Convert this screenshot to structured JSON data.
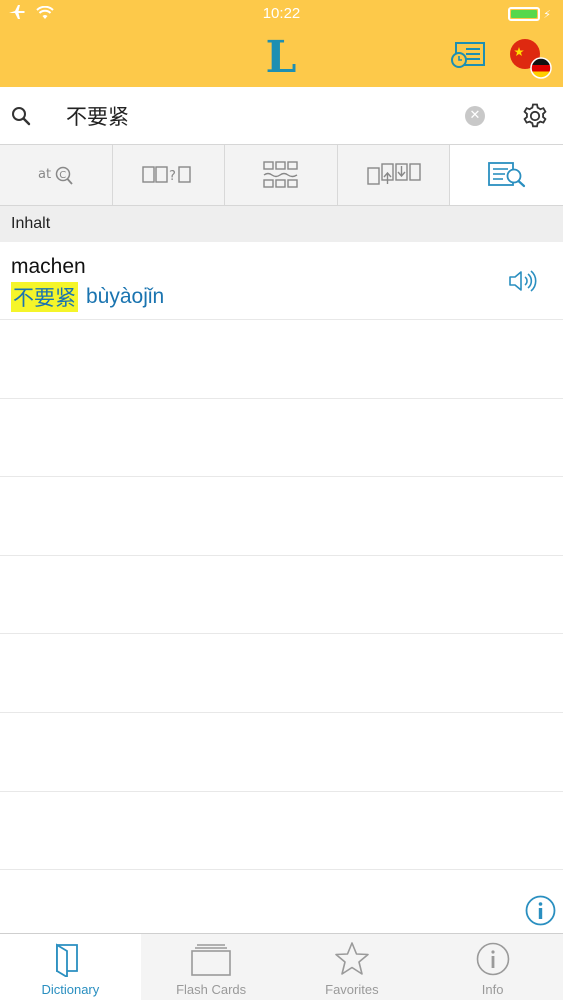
{
  "status_bar": {
    "time": "10:22"
  },
  "header": {
    "logo_letter": "L"
  },
  "search": {
    "query": "不要紧"
  },
  "mode_tabs": [
    {
      "icon": "spellcheck-search-icon",
      "text": "at"
    },
    {
      "icon": "character-guess-icon",
      "text": ""
    },
    {
      "icon": "grid-compare-icon",
      "text": ""
    },
    {
      "icon": "flashcard-transfer-icon",
      "text": ""
    },
    {
      "icon": "fulltext-search-icon",
      "text": "",
      "active": true
    }
  ],
  "section": {
    "title": "Inhalt"
  },
  "results": [
    {
      "headword": "machen",
      "hanzi": "不要紧",
      "pinyin": "bùyàojǐn"
    }
  ],
  "tabbar": [
    {
      "label": "Dictionary",
      "icon": "book-icon",
      "active": true
    },
    {
      "label": "Flash Cards",
      "icon": "cards-icon",
      "active": false
    },
    {
      "label": "Favorites",
      "icon": "star-icon",
      "active": false
    },
    {
      "label": "Info",
      "icon": "info-icon",
      "active": false
    }
  ],
  "colors": {
    "header_bg": "#fdc94a",
    "accent": "#2a8fc0",
    "highlight": "#f5f52a",
    "pinyin": "#1a74b0"
  }
}
